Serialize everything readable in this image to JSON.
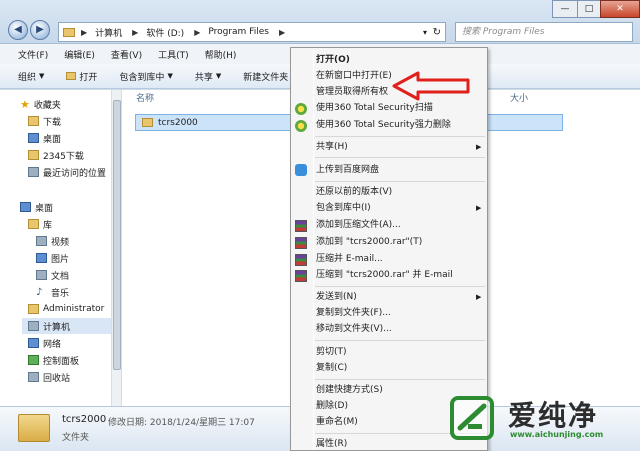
{
  "window": {
    "minimize_glyph": "—",
    "maximize_glyph": "□",
    "close_glyph": "✕"
  },
  "address_bar": {
    "back_glyph": "◀",
    "forward_glyph": "▶",
    "dropdown_glyph": "▾",
    "crumbs": [
      "计算机",
      "软件 (D:)",
      "Program Files"
    ],
    "refresh_glyph": "↻",
    "search_placeholder": "搜索 Program Files"
  },
  "menubar": [
    "文件(F)",
    "编辑(E)",
    "查看(V)",
    "工具(T)",
    "帮助(H)"
  ],
  "toolbar": [
    "组织",
    "打开",
    "包含到库中",
    "共享",
    "新建文件夹"
  ],
  "nav": {
    "favorites": "收藏夹",
    "downloads": "下载",
    "desktop_fav": "桌面",
    "dl2345": "2345下载",
    "recent": "最近访问的位置",
    "desktop": "桌面",
    "libraries": "库",
    "videos": "视频",
    "pictures": "图片",
    "documents": "文档",
    "music": "音乐",
    "admin": "Administrator",
    "computer": "计算机",
    "network": "网络",
    "control_panel": "控制面板",
    "recycle_bin": "回收站"
  },
  "content": {
    "col_name": "名称",
    "col_size": "大小",
    "file_name": "tcrs2000"
  },
  "details": {
    "name": "tcrs2000",
    "modified_label": "修改日期: 2018/1/24/星期三 17:07",
    "type": "文件夹"
  },
  "context_menu": {
    "open": "打开(O)",
    "open_new_window": "在新窗口中打开(E)",
    "take_ownership": "管理员取得所有权",
    "scan_360": "使用360 Total Security扫描",
    "delete_360": "使用360 Total Security强力删除",
    "share": "共享(H)",
    "upload_baidu": "上传到百度网盘",
    "restore_versions": "还原以前的版本(V)",
    "include_library": "包含到库中(I)",
    "add_archive": "添加到压缩文件(A)...",
    "add_rar": "添加到 \"tcrs2000.rar\"(T)",
    "compress_email": "压缩并 E-mail...",
    "compress_rar_email": "压缩到 \"tcrs2000.rar\" 并 E-mail",
    "send_to": "发送到(N)",
    "copy_to_folder": "复制到文件夹(F)...",
    "move_to_folder": "移动到文件夹(V)...",
    "cut": "剪切(T)",
    "copy": "复制(C)",
    "create_shortcut": "创建快捷方式(S)",
    "delete": "删除(D)",
    "rename": "重命名(M)",
    "properties": "属性(R)",
    "submenu_glyph": "▶"
  },
  "watermark": {
    "text": "爱纯净",
    "url": "www.aichunjing.com"
  },
  "colors": {
    "annotation_red": "#e0201b",
    "selection": "#cce4fa",
    "watermark_green": "#2d8b31"
  }
}
